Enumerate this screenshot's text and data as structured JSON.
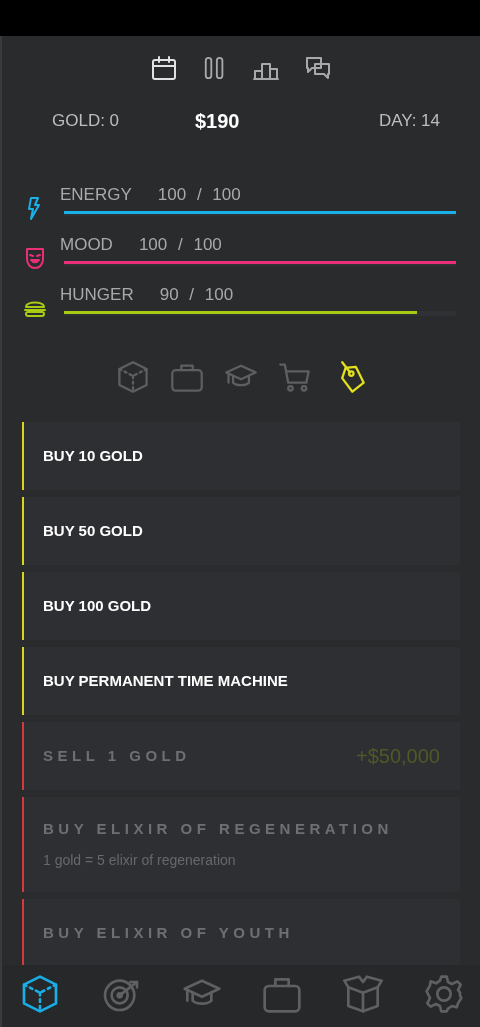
{
  "top_icons": [
    {
      "selected": true
    },
    {
      "selected": false
    },
    {
      "selected": false
    },
    {
      "selected": false
    }
  ],
  "summary": {
    "gold": "GOLD: 0",
    "money": "$190",
    "day": "DAY: 14"
  },
  "stats": [
    {
      "label": "ENERGY",
      "reading": "100 / 100",
      "level": 1.0,
      "color": "#1ab0e8"
    },
    {
      "label": "MOOD",
      "reading": "100 / 100",
      "level": 1.0,
      "color": "#ea2e78"
    },
    {
      "label": "HUNGER",
      "reading": "90 / 100",
      "level": 0.9,
      "color": "#a8cc14"
    }
  ],
  "categories": [
    {
      "selected": false
    },
    {
      "selected": false
    },
    {
      "selected": false
    },
    {
      "selected": false
    },
    {
      "selected": true
    }
  ],
  "items": [
    {
      "kind": "available",
      "title": "BUY 10 GOLD"
    },
    {
      "kind": "available",
      "title": "BUY 50 GOLD"
    },
    {
      "kind": "available",
      "title": "BUY 100 GOLD"
    },
    {
      "kind": "available",
      "title": "BUY PERMANENT TIME MACHINE"
    },
    {
      "kind": "locked",
      "title": "SELL 1 GOLD",
      "price": "+$50,000"
    },
    {
      "kind": "locked",
      "title": "BUY ELIXIR OF REGENERATION",
      "subtitle": "1 gold = 5 elixir of regeneration"
    },
    {
      "kind": "locked",
      "title": "BUY ELIXIR OF YOUTH"
    }
  ],
  "bottom_nav": [
    {
      "selected": true
    },
    {
      "selected": false
    },
    {
      "selected": false
    },
    {
      "selected": false
    },
    {
      "selected": false
    },
    {
      "selected": false
    }
  ]
}
